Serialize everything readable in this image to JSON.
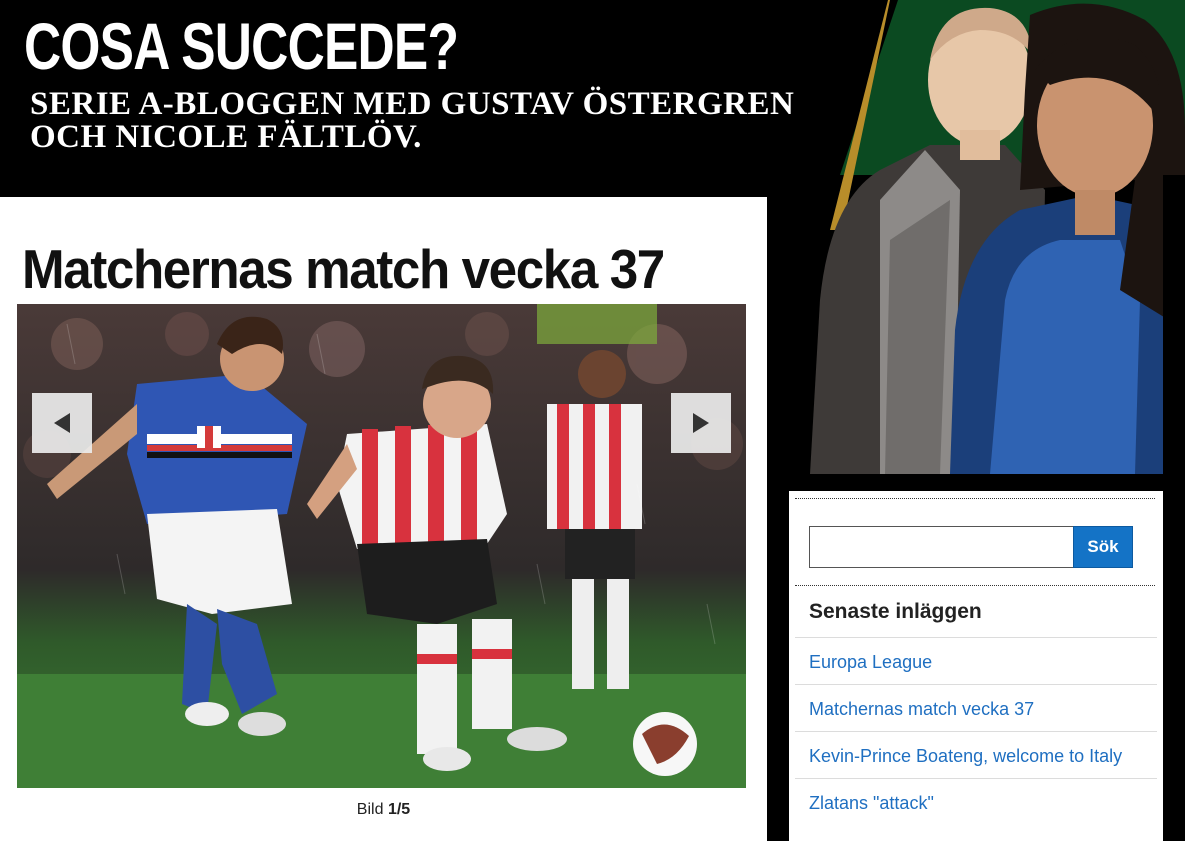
{
  "header": {
    "title": "COSA SUCCEDE?",
    "subtitle_line1": "SERIE A-BLOGGEN MED GUSTAV ÖSTERGREN",
    "subtitle_line2": "OCH NICOLE FÄLTLÖV."
  },
  "post": {
    "title": "Matchernas match vecka 37",
    "caption_prefix": "Bild",
    "caption_index": "1/5"
  },
  "slideshow": {
    "prev_icon": "left-triangle-arrow",
    "next_icon": "right-triangle-arrow"
  },
  "sidebar": {
    "search_placeholder": "",
    "search_button": "Sök",
    "recent_heading": "Senaste inläggen",
    "recent_posts": [
      "Europa League",
      "Matchernas match vecka 37",
      "Kevin-Prince Boateng, welcome to Italy",
      "Zlatans \"attack\""
    ]
  },
  "colors": {
    "link": "#1f6fc1",
    "search_button": "#1473c6",
    "header_bg": "#000000",
    "stripe_green": "#0b4a21",
    "stripe_gold": "#b88d2a"
  }
}
